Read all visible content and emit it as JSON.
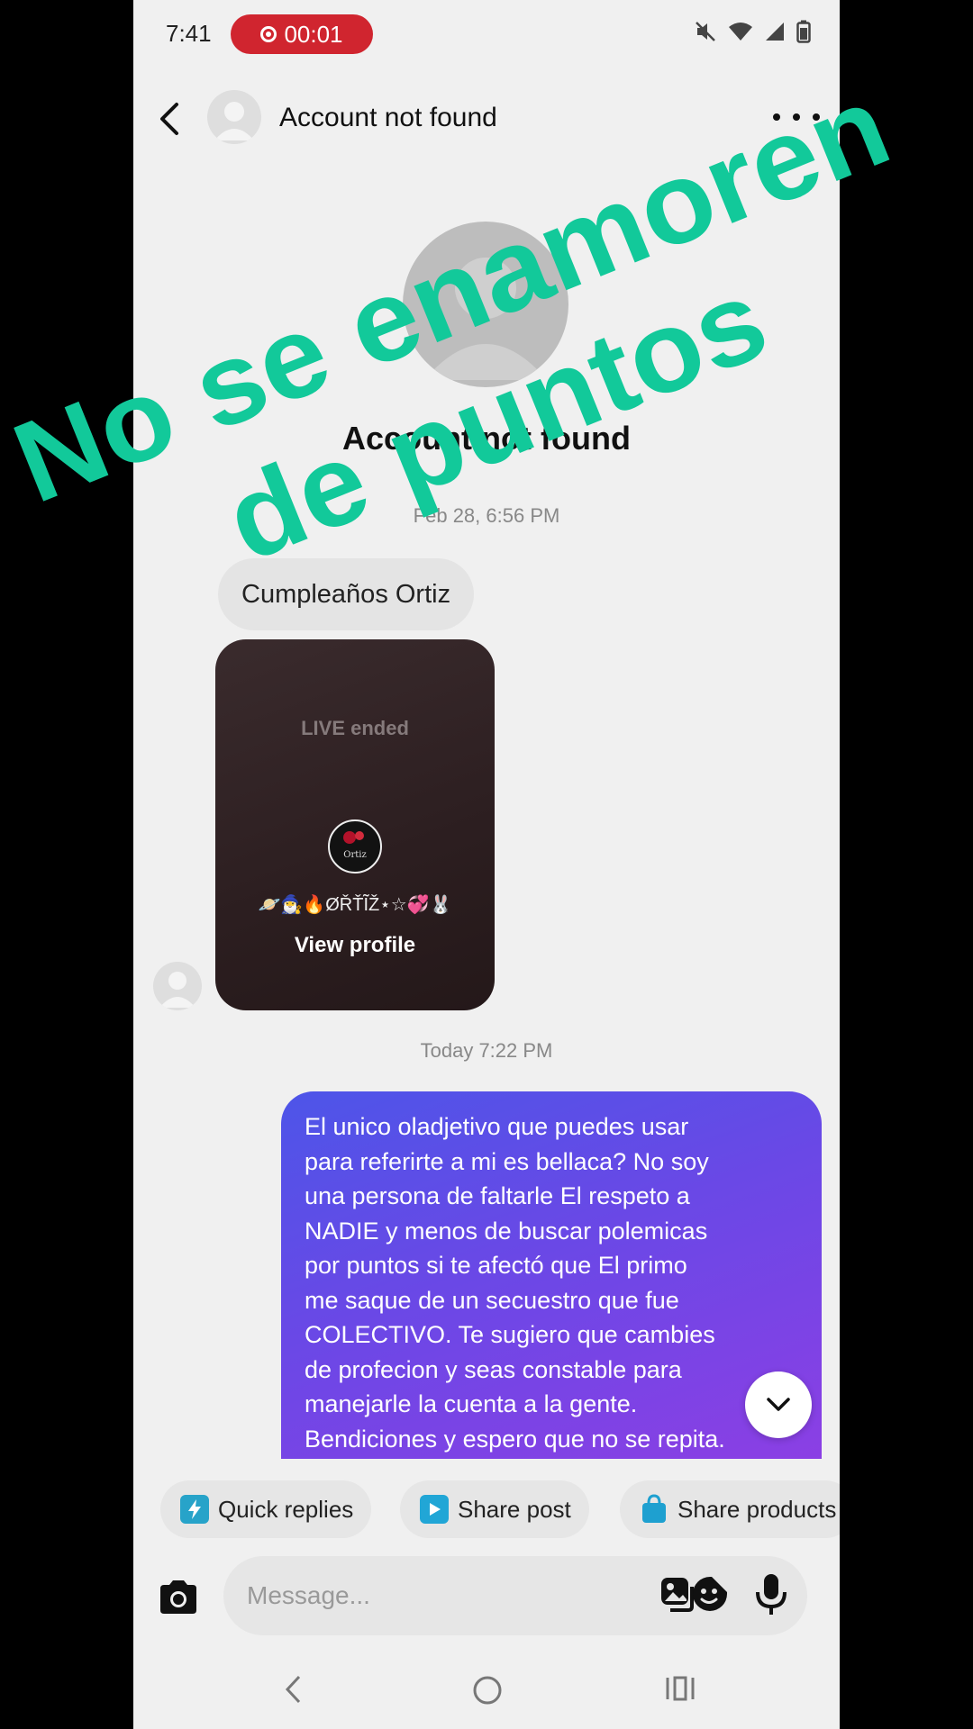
{
  "status_bar": {
    "time": "7:41",
    "recording": "00:01"
  },
  "header": {
    "title": "Account not found"
  },
  "profile": {
    "name": "Account not found",
    "date": "Feb 28, 6:56 PM"
  },
  "messages": {
    "received_text": "Cumpleaños Ortiz",
    "live_card": {
      "status": "LIVE ended",
      "handle": "🪐🧙‍♂️🔥ØŘŤĨŽ⋆☆💞🐰",
      "action": "View profile"
    },
    "date2": "Today 7:22 PM",
    "sent_lines": [
      "El unico oladjetivo que puedes usar",
      "para referirte a mi es bellaca? No soy",
      "una persona de faltarle El respeto a",
      "NADIE y menos de buscar polemicas",
      "por puntos si te afectó que El primo",
      "me saque de un secuestro que fue",
      "COLECTIVO. Te sugiero que cambies",
      "de profecion y seas constable para",
      "manejarle la cuenta a la gente.",
      "Bendiciones y espero que no se repita."
    ]
  },
  "quick_actions": [
    {
      "label": "Quick replies",
      "icon": "lightning-icon",
      "color": "#27a3c9"
    },
    {
      "label": "Share post",
      "icon": "play-icon",
      "color": "#21a6d6"
    },
    {
      "label": "Share products",
      "icon": "shopping-bag-icon",
      "color": "#1ea0d0"
    }
  ],
  "composer": {
    "placeholder": "Message..."
  },
  "overlay": {
    "line1": "No se enamoren",
    "line2": "de puntos",
    "color": "#12c99a"
  }
}
